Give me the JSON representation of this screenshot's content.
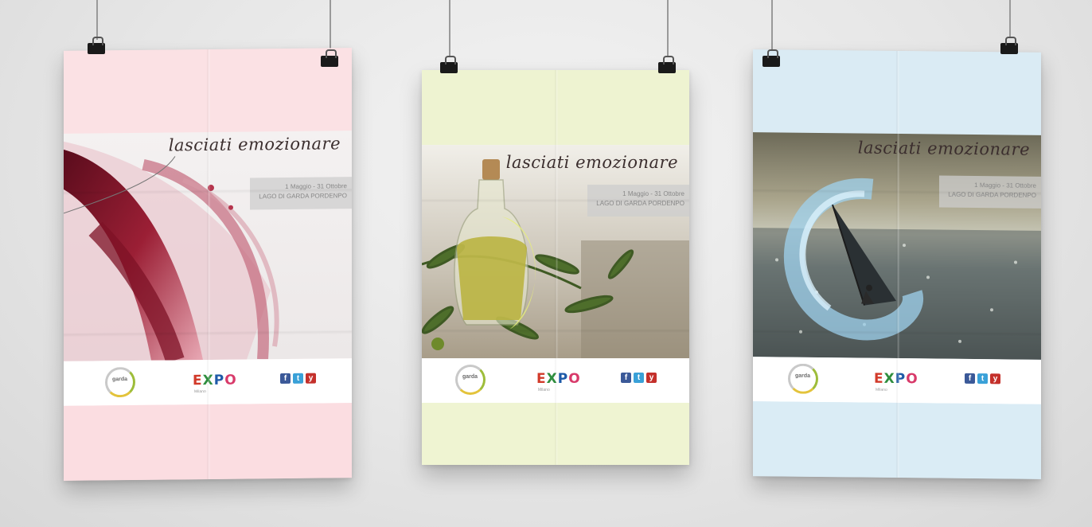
{
  "scene": {
    "background_color": "#e9e9e9",
    "posters": [
      {
        "theme": "wine",
        "band_color": "#fbe3e5",
        "tagline": "lasciati emozionare",
        "info_line1": "1 Maggio - 31 Ottobre",
        "info_line2": "LAGO DI GARDA PORDENPO",
        "logo_text": "garda",
        "expo_letters": [
          "E",
          "X",
          "P",
          "O"
        ],
        "expo_sub": "Milano",
        "social_icons": [
          "facebook-icon",
          "twitter-icon",
          "youtube-icon"
        ]
      },
      {
        "theme": "olive-oil",
        "band_color": "#f1f5d6",
        "tagline": "lasciati emozionare",
        "info_line1": "1 Maggio - 31 Ottobre",
        "info_line2": "LAGO DI GARDA PORDENPO",
        "logo_text": "garda",
        "expo_letters": [
          "E",
          "X",
          "P",
          "O"
        ],
        "expo_sub": "Milano",
        "social_icons": [
          "facebook-icon",
          "twitter-icon",
          "youtube-icon"
        ]
      },
      {
        "theme": "windsurf",
        "band_color": "#dcedf5",
        "tagline": "lasciati emozionare",
        "info_line1": "1 Maggio - 31 Ottobre",
        "info_line2": "LAGO DI GARDA PORDENPO",
        "logo_text": "garda",
        "expo_letters": [
          "E",
          "X",
          "P",
          "O"
        ],
        "expo_sub": "Milano",
        "social_icons": [
          "facebook-icon",
          "twitter-icon",
          "youtube-icon"
        ]
      }
    ]
  }
}
